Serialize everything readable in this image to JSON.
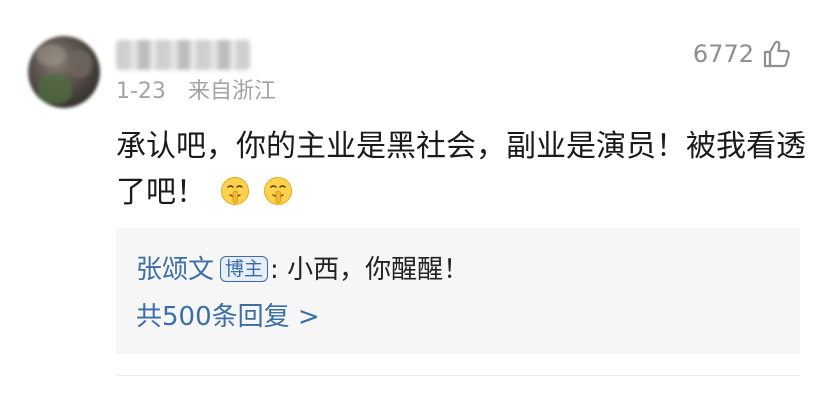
{
  "comment": {
    "username": "",
    "date": "1-23",
    "location": "来自浙江",
    "likes": "6772",
    "text": "承认吧，你的主业是黑社会，副业是演员！被我看透了吧！",
    "emojis": [
      "shushing-face",
      "shushing-face"
    ]
  },
  "reply": {
    "author": "张颂文",
    "badge": "博主",
    "separator": ": ",
    "text": "小西，你醒醒！",
    "more": "共500条回复 >"
  },
  "colors": {
    "link": "#3b6ea8",
    "meta": "#a3a3a3",
    "reply_bg": "#f6f6f6"
  }
}
